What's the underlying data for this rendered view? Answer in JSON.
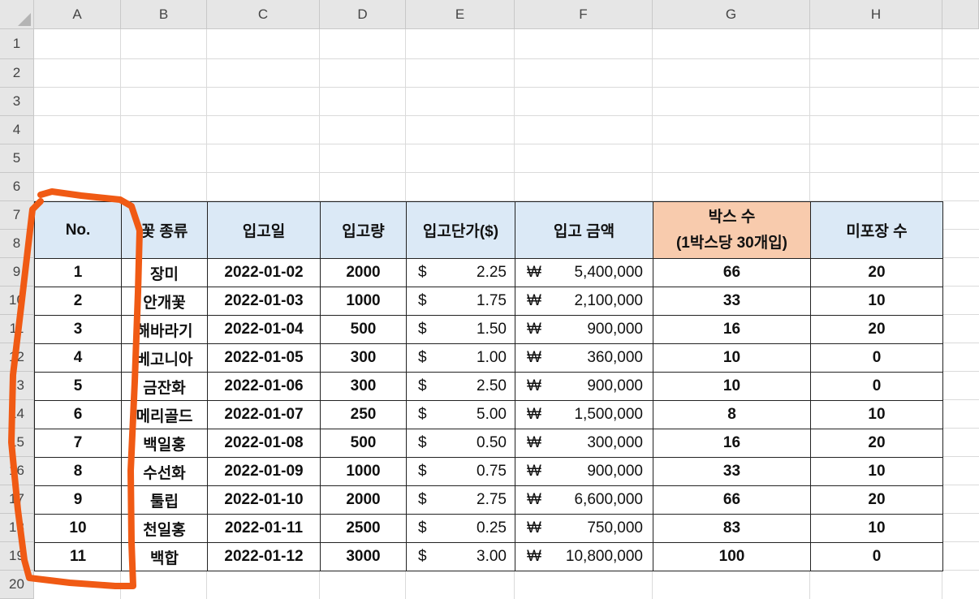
{
  "columns": [
    "A",
    "B",
    "C",
    "D",
    "E",
    "F",
    "G",
    "H"
  ],
  "rows": [
    "1",
    "2",
    "3",
    "4",
    "5",
    "6",
    "7",
    "8",
    "9",
    "10",
    "11",
    "12",
    "13",
    "14",
    "15",
    "16",
    "17",
    "18",
    "19",
    "20"
  ],
  "table": {
    "headers": {
      "no": "No.",
      "flower": "꽃 종류",
      "date": "입고일",
      "qty": "입고량",
      "unit_price": "입고단가($)",
      "amount": "입고 금액",
      "boxes_line1": "박스 수",
      "boxes_line2": "(1박스당 30개입)",
      "unpacked": "미포장 수"
    },
    "rows": [
      {
        "no": "1",
        "flower": "장미",
        "date": "2022-01-02",
        "qty": "2000",
        "dollar": "$",
        "price": "2.25",
        "won": "₩",
        "amount": "5,400,000",
        "boxes": "66",
        "unpacked": "20"
      },
      {
        "no": "2",
        "flower": "안개꽃",
        "date": "2022-01-03",
        "qty": "1000",
        "dollar": "$",
        "price": "1.75",
        "won": "₩",
        "amount": "2,100,000",
        "boxes": "33",
        "unpacked": "10"
      },
      {
        "no": "3",
        "flower": "해바라기",
        "date": "2022-01-04",
        "qty": "500",
        "dollar": "$",
        "price": "1.50",
        "won": "₩",
        "amount": "900,000",
        "boxes": "16",
        "unpacked": "20"
      },
      {
        "no": "4",
        "flower": "베고니아",
        "date": "2022-01-05",
        "qty": "300",
        "dollar": "$",
        "price": "1.00",
        "won": "₩",
        "amount": "360,000",
        "boxes": "10",
        "unpacked": "0"
      },
      {
        "no": "5",
        "flower": "금잔화",
        "date": "2022-01-06",
        "qty": "300",
        "dollar": "$",
        "price": "2.50",
        "won": "₩",
        "amount": "900,000",
        "boxes": "10",
        "unpacked": "0"
      },
      {
        "no": "6",
        "flower": "메리골드",
        "date": "2022-01-07",
        "qty": "250",
        "dollar": "$",
        "price": "5.00",
        "won": "₩",
        "amount": "1,500,000",
        "boxes": "8",
        "unpacked": "10"
      },
      {
        "no": "7",
        "flower": "백일홍",
        "date": "2022-01-08",
        "qty": "500",
        "dollar": "$",
        "price": "0.50",
        "won": "₩",
        "amount": "300,000",
        "boxes": "16",
        "unpacked": "20"
      },
      {
        "no": "8",
        "flower": "수선화",
        "date": "2022-01-09",
        "qty": "1000",
        "dollar": "$",
        "price": "0.75",
        "won": "₩",
        "amount": "900,000",
        "boxes": "33",
        "unpacked": "10"
      },
      {
        "no": "9",
        "flower": "툴립",
        "date": "2022-01-10",
        "qty": "2000",
        "dollar": "$",
        "price": "2.75",
        "won": "₩",
        "amount": "6,600,000",
        "boxes": "66",
        "unpacked": "20"
      },
      {
        "no": "10",
        "flower": "천일홍",
        "date": "2022-01-11",
        "qty": "2500",
        "dollar": "$",
        "price": "0.25",
        "won": "₩",
        "amount": "750,000",
        "boxes": "83",
        "unpacked": "10"
      },
      {
        "no": "11",
        "flower": "백합",
        "date": "2022-01-12",
        "qty": "3000",
        "dollar": "$",
        "price": "3.00",
        "won": "₩",
        "amount": "10,800,000",
        "boxes": "100",
        "unpacked": "0"
      }
    ]
  },
  "colors": {
    "header_fill": "#dbe9f6",
    "boxes_header_fill": "#f8cbad",
    "annotation": "#f05a14"
  }
}
